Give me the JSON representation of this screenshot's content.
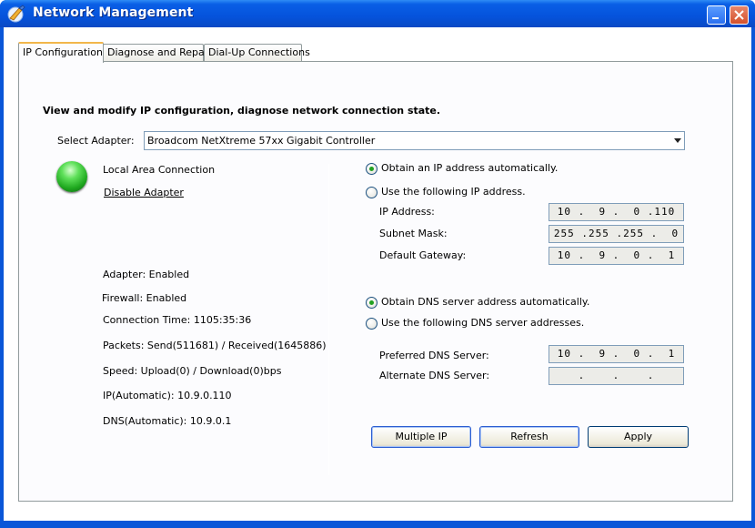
{
  "window": {
    "title": "Network Management"
  },
  "tabs": [
    {
      "label": "IP Configuration"
    },
    {
      "label": "Diagnose and Repair"
    },
    {
      "label": "Dial-Up Connections"
    }
  ],
  "ip_config": {
    "heading": "View and modify IP configuration, diagnose network connection state.",
    "select_adapter_label": "Select Adapter:",
    "adapter_value": "Broadcom NetXtreme 57xx Gigabit Controller",
    "connection_name": "Local Area Connection",
    "disable_link": "Disable Adapter",
    "status_lines": [
      "Adapter: Enabled",
      "Firewall: Enabled",
      "Connection Time: 1105:35:36",
      "Packets: Send(511681) / Received(1645886)",
      "Speed: Upload(0) / Download(0)bps",
      "IP(Automatic): 10.9.0.110",
      "DNS(Automatic): 10.9.0.1"
    ],
    "ip_auto_label": "Obtain an IP address automatically.",
    "ip_manual_label": "Use the following IP address.",
    "ip_address_label": "IP Address:",
    "ip_address_value": "10 .  9 .  0 .110",
    "subnet_label": "Subnet Mask:",
    "subnet_value": "255 .255 .255 .  0",
    "gateway_label": "Default Gateway:",
    "gateway_value": "10 .  9 .  0 .  1",
    "dns_auto_label": "Obtain DNS server address automatically.",
    "dns_manual_label": "Use the following DNS server addresses.",
    "preferred_dns_label": "Preferred DNS Server:",
    "preferred_dns_value": "10 .  9 .  0 .  1",
    "alternate_dns_label": "Alternate DNS Server:",
    "alternate_dns_value": ".    .    .",
    "ip_mode": "automatic",
    "dns_mode": "automatic",
    "status_color": "#2fc22f"
  },
  "buttons": {
    "multiple_ip": "Multiple IP",
    "refresh": "Refresh",
    "apply": "Apply"
  }
}
